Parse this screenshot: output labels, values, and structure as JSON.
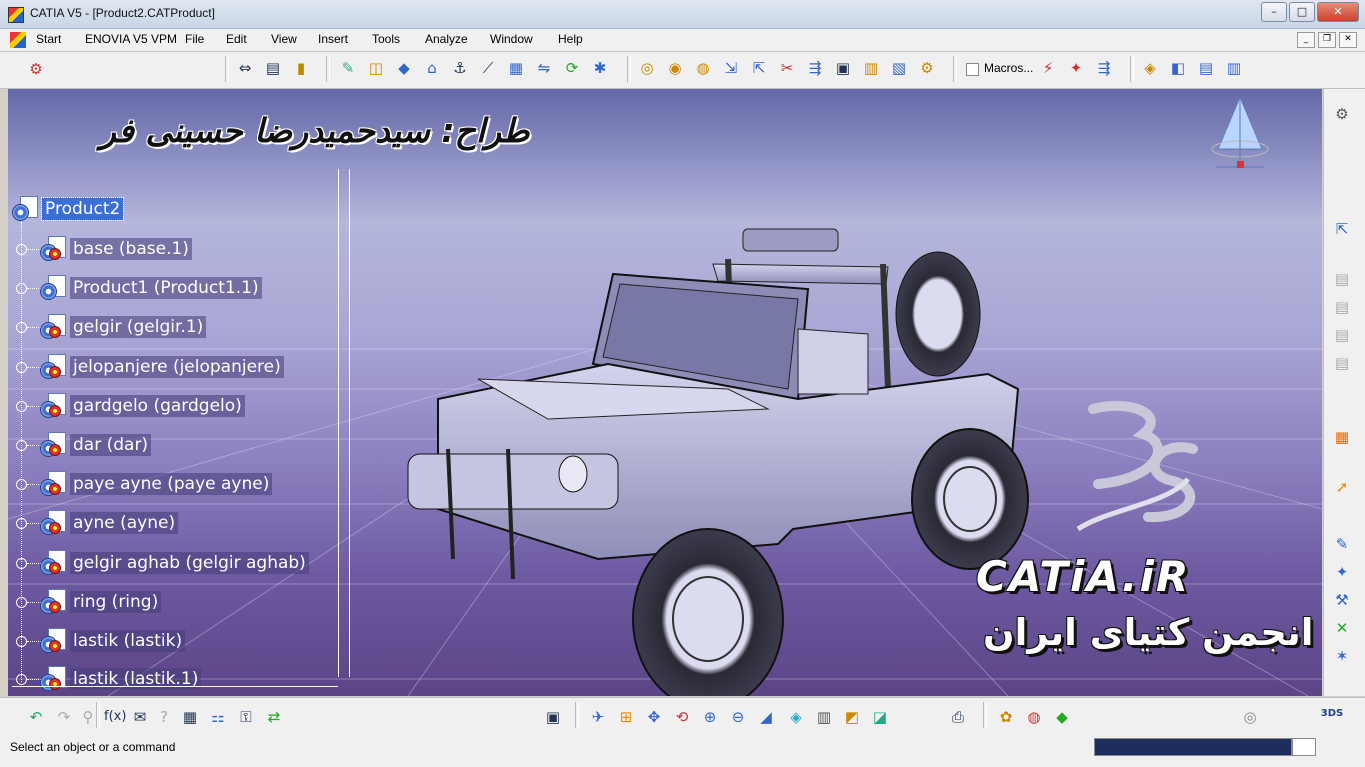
{
  "window": {
    "title": "CATIA V5 - [Product2.CATProduct]"
  },
  "menu": [
    "Start",
    "ENOVIA V5 VPM",
    "File",
    "Edit",
    "View",
    "Insert",
    "Tools",
    "Analyze",
    "Window",
    "Help"
  ],
  "toolbar": {
    "macros_label": "Macros..."
  },
  "overlay": {
    "designer_text": "طراح: سیدحمیدرضا حسینی فر",
    "brand_text": "CATiA.iR",
    "brand_fa": "انجمن کتیای ایران"
  },
  "tree": {
    "root": "Product2",
    "children": [
      "base (base.1)",
      "Product1 (Product1.1)",
      "gelgir (gelgir.1)",
      "jelopanjere (jelopanjere)",
      "gardgelo (gardgelo)",
      "dar (dar)",
      "paye ayne (paye ayne)",
      "ayne (ayne)",
      "gelgir aghab (gelgir aghab)",
      "ring (ring)",
      "lastik (lastik)",
      "lastik (lastik.1)"
    ]
  },
  "status": {
    "message": "Select an object or a command"
  },
  "colors": {
    "selection": "#3a6fd8",
    "viewport_top": "#6468a8",
    "viewport_bottom": "#5b4587",
    "model": "#b9b9d9"
  }
}
